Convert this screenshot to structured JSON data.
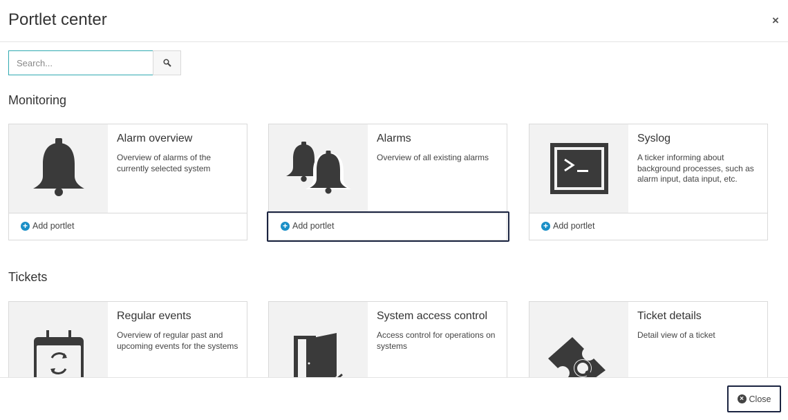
{
  "dialog": {
    "title": "Portlet center",
    "close_icon": "×"
  },
  "search": {
    "placeholder": "Search...",
    "value": ""
  },
  "sections": [
    {
      "title": "Monitoring",
      "cards": [
        {
          "title": "Alarm overview",
          "description": "Overview of alarms of the currently selected system",
          "icon": "bell-icon",
          "add_label": "Add portlet"
        },
        {
          "title": "Alarms",
          "description": "Overview of all existing alarms",
          "icon": "bells-icon",
          "add_label": "Add portlet"
        },
        {
          "title": "Syslog",
          "description": "A ticker informing about background processes, such as alarm input, data input, etc.",
          "icon": "terminal-icon",
          "add_label": "Add portlet"
        }
      ]
    },
    {
      "title": "Tickets",
      "cards": [
        {
          "title": "Regular events",
          "description": "Overview of regular past and upcoming events for the systems",
          "icon": "recurring-calendar-icon"
        },
        {
          "title": "System access control",
          "description": "Access control for operations on systems",
          "icon": "door-check-icon"
        },
        {
          "title": "Ticket details",
          "description": "Detail view of a ticket",
          "icon": "ticket-search-icon"
        }
      ]
    }
  ],
  "footer": {
    "close_label": "Close"
  },
  "colors": {
    "accent": "#1a8fc7",
    "focus_border": "#1a2340",
    "search_border": "#2fa9b0",
    "icon": "#3a3a3a"
  }
}
